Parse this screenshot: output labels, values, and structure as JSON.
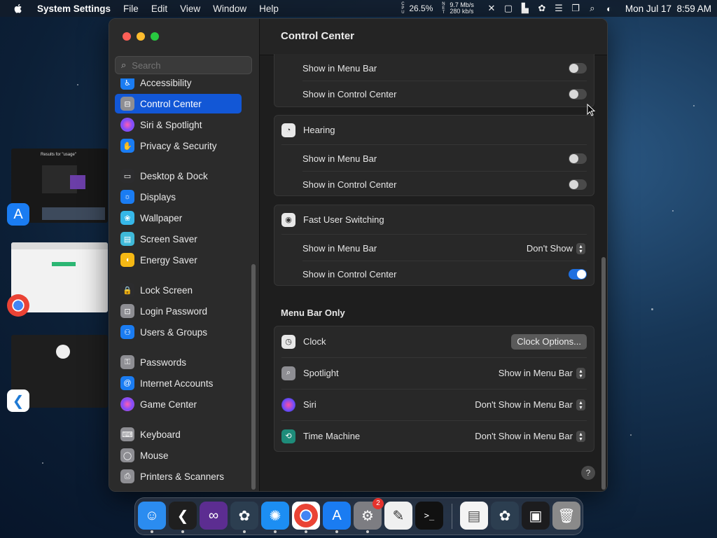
{
  "menubar": {
    "app_name": "System Settings",
    "menus": [
      "File",
      "Edit",
      "View",
      "Window",
      "Help"
    ],
    "cpu_label": "C P U",
    "cpu_percent": "26.5%",
    "net_label": "N E T",
    "net_up": "9.7 Mb/s",
    "net_down": "280 kb/s",
    "datetime": "Mon Jul 17  8:59 AM",
    "icons": [
      "apple-icon",
      "close-x-icon",
      "screenshot-icon",
      "status-icon",
      "bee-icon",
      "sidebar-icon",
      "windows-icon",
      "search-icon",
      "control-center-icon"
    ]
  },
  "window": {
    "traffic": {
      "close": "#fe5f57",
      "minimize": "#febc2e",
      "zoom": "#28c840"
    },
    "search": {
      "placeholder": "Search"
    },
    "sidebar": {
      "items": [
        {
          "label": "Accessibility",
          "color": "#1a7cf2",
          "icon": "accessibility-icon"
        },
        {
          "label": "Control Center",
          "color": "#8e8e93",
          "icon": "control-center-icon",
          "selected": true
        },
        {
          "label": "Siri & Spotlight",
          "color": "#b55cd6",
          "icon": "siri-icon"
        },
        {
          "label": "Privacy & Security",
          "color": "#1a7cf2",
          "icon": "hand-icon"
        },
        {
          "label": "Desktop & Dock",
          "color": "#2c2c2e",
          "icon": "dock-icon"
        },
        {
          "label": "Displays",
          "color": "#1a7cf2",
          "icon": "display-icon"
        },
        {
          "label": "Wallpaper",
          "color": "#36b7e8",
          "icon": "wallpaper-icon"
        },
        {
          "label": "Screen Saver",
          "color": "#3fb9d8",
          "icon": "screensaver-icon"
        },
        {
          "label": "Energy Saver",
          "color": "#f5b814",
          "icon": "battery-icon"
        },
        {
          "label": "Lock Screen",
          "color": "#2c2c2e",
          "icon": "lock-icon"
        },
        {
          "label": "Login Password",
          "color": "#8e8e93",
          "icon": "key-lock-icon"
        },
        {
          "label": "Users & Groups",
          "color": "#1a7cf2",
          "icon": "users-icon"
        },
        {
          "label": "Passwords",
          "color": "#8e8e93",
          "icon": "key-icon"
        },
        {
          "label": "Internet Accounts",
          "color": "#1a7cf2",
          "icon": "at-icon"
        },
        {
          "label": "Game Center",
          "color": "#e94e8a",
          "icon": "game-center-icon"
        },
        {
          "label": "Keyboard",
          "color": "#8e8e93",
          "icon": "keyboard-icon"
        },
        {
          "label": "Mouse",
          "color": "#8e8e93",
          "icon": "mouse-icon"
        },
        {
          "label": "Printers & Scanners",
          "color": "#8e8e93",
          "icon": "printer-icon"
        }
      ]
    },
    "main": {
      "title": "Control Center",
      "group0": {
        "rows": [
          {
            "label": "Show in Menu Bar",
            "on": false
          },
          {
            "label": "Show in Control Center",
            "on": false
          }
        ]
      },
      "hearing": {
        "title": "Hearing",
        "rows": [
          {
            "label": "Show in Menu Bar",
            "on": false
          },
          {
            "label": "Show in Control Center",
            "on": false
          }
        ]
      },
      "fast_user": {
        "title": "Fast User Switching",
        "menu_bar_label": "Show in Menu Bar",
        "menu_bar_value": "Don't Show",
        "cc_label": "Show in Control Center",
        "cc_on": true
      },
      "menu_bar_only": {
        "heading": "Menu Bar Only",
        "clock": {
          "label": "Clock",
          "button": "Clock Options..."
        },
        "spotlight": {
          "label": "Spotlight",
          "value": "Show in Menu Bar"
        },
        "siri": {
          "label": "Siri",
          "value": "Don't Show in Menu Bar"
        },
        "time_machine": {
          "label": "Time Machine",
          "value": "Don't Show in Menu Bar"
        }
      },
      "help": "?"
    }
  },
  "desktop": {
    "thumb_title": "Results for \"usage\""
  },
  "dock": {
    "apps": [
      {
        "name": "Finder",
        "color": "#2b8cf0",
        "icon": "finder-icon"
      },
      {
        "name": "Visual Studio Code",
        "color": "#1f1f1f",
        "icon": "vscode-icon"
      },
      {
        "name": "Visual Studio",
        "color": "#5c2d91",
        "icon": "visual-studio-icon"
      },
      {
        "name": "Bee",
        "color": "#2c3e50",
        "icon": "bee-icon"
      },
      {
        "name": "Safari",
        "color": "#1c8ef3",
        "icon": "safari-icon"
      },
      {
        "name": "Chrome",
        "color": "#ffffff",
        "icon": "chrome-icon"
      },
      {
        "name": "App Store",
        "color": "#1a7cf2",
        "icon": "app-store-icon"
      },
      {
        "name": "System Settings",
        "color": "#7d7d82",
        "icon": "settings-gear-icon",
        "badge": "2"
      },
      {
        "name": "TextEdit",
        "color": "#f0f0f0",
        "icon": "textedit-icon"
      },
      {
        "name": "Terminal",
        "color": "#111111",
        "icon": "terminal-icon"
      }
    ],
    "docs": [
      {
        "name": "Document",
        "color": "#f4f4f4",
        "icon": "document-icon"
      },
      {
        "name": "Bee Archive",
        "color": "#2c3e50",
        "icon": "bee-icon"
      },
      {
        "name": "Finder Window",
        "color": "#1c1c1e",
        "icon": "finder-window-icon"
      },
      {
        "name": "Trash",
        "color": "#8a8a8a",
        "icon": "trash-icon"
      }
    ],
    "terminal_glyph": ">_"
  }
}
